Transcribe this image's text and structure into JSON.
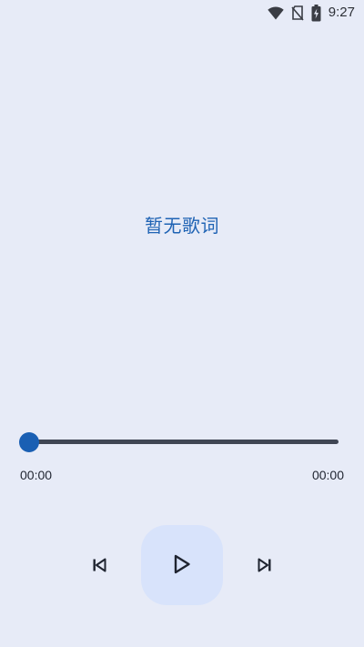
{
  "status_bar": {
    "time": "9:27",
    "icons": [
      "wifi-icon",
      "no-sim-icon",
      "battery-charging-icon"
    ]
  },
  "player": {
    "lyrics_text": "暂无歌词",
    "elapsed": "00:00",
    "duration": "00:00",
    "progress": 0,
    "controls": [
      "skip-previous-icon",
      "play-icon",
      "skip-next-icon"
    ]
  },
  "colors": {
    "background": "#e7ebf7",
    "accent": "#1a5fb3",
    "lyrics": "#1f63b4",
    "play_button_bg": "#d8e3fb",
    "track": "#404654"
  }
}
